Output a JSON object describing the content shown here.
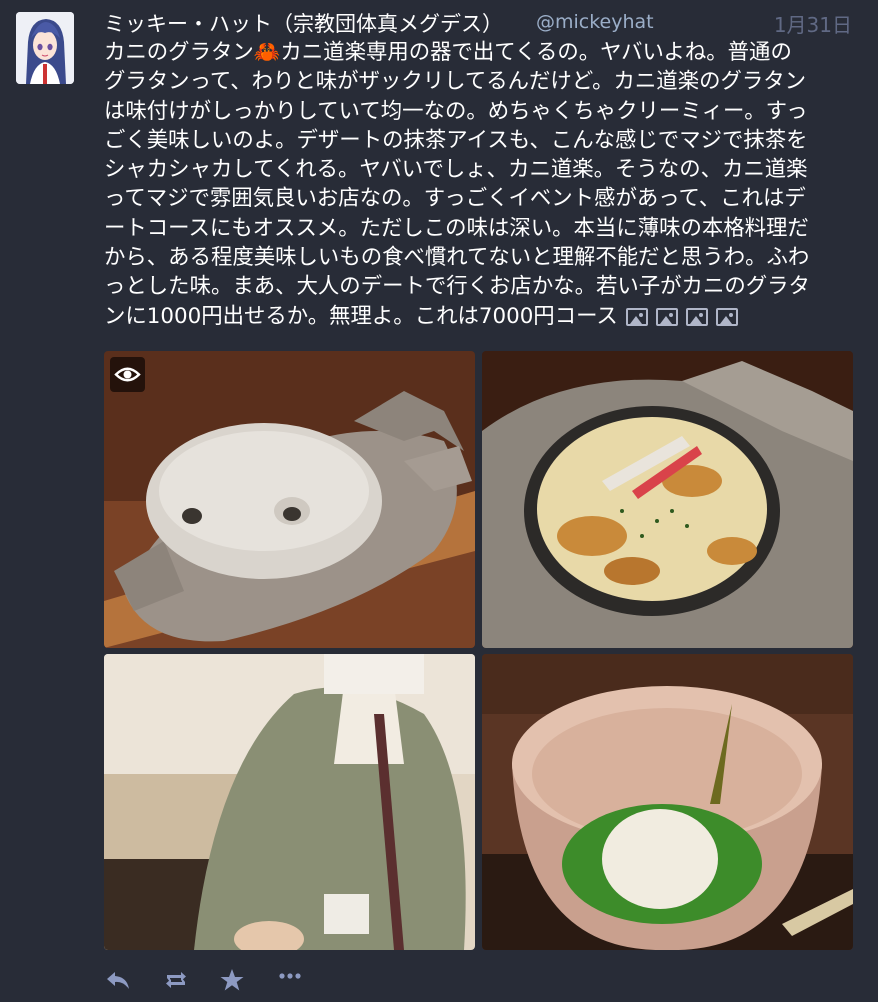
{
  "status": {
    "display_name": "ミッキー・ハット（宗教団体真メグデス）",
    "username": "@mickeyhat",
    "timestamp": "1月31日",
    "content_lines": [
      {
        "before": "カニのグラタン",
        "emoji": "🦀",
        "after": "カニ道楽専用の器で出てくるの。ヤバいよね。普通の"
      },
      {
        "text": "グラタンって、わりと味がザックリしてるんだけど。カニ道楽のグラタン"
      },
      {
        "text": "は味付けがしっかりしていて均一なの。めちゃくちゃクリーミィー。すっ"
      },
      {
        "text": "ごく美味しいのよ。デザートの抹茶アイスも、こんな感じでマジで抹茶を"
      },
      {
        "text": "シャカシャカしてくれる。ヤバいでしょ、カニ道楽。そうなの、カニ道楽"
      },
      {
        "text": "ってマジで雰囲気良いお店なの。すっごくイベント感があって、これはデ"
      },
      {
        "text": "ートコースにもオススメ。ただしこの味は深い。本当に薄味の本格料理だ"
      },
      {
        "text": "から、ある程度美味しいもの食べ慣れてないと理解不能だと思うわ。ふわ"
      },
      {
        "text": "っとした味。まあ、大人のデートで行くお店かな。若い子がカニのグラタ"
      },
      {
        "text": "ンに1000円出せるか。無理よ。これは7000円コース"
      }
    ],
    "attachment_icons": [
      "picture-icon",
      "picture-icon",
      "picture-icon",
      "picture-icon"
    ],
    "media": [
      {
        "name": "crab-shaped-ceramic-dish"
      },
      {
        "name": "crab-gratin"
      },
      {
        "name": "server-in-kimono"
      },
      {
        "name": "matcha-ice-cream-bowl"
      }
    ],
    "actions": [
      "reply-icon",
      "boost-icon",
      "favourite-icon",
      "more-icon"
    ]
  },
  "colors": {
    "background": "#282c37",
    "username": "#9baec8",
    "timestamp": "#606984",
    "action_icon": "#8d9ac2"
  }
}
